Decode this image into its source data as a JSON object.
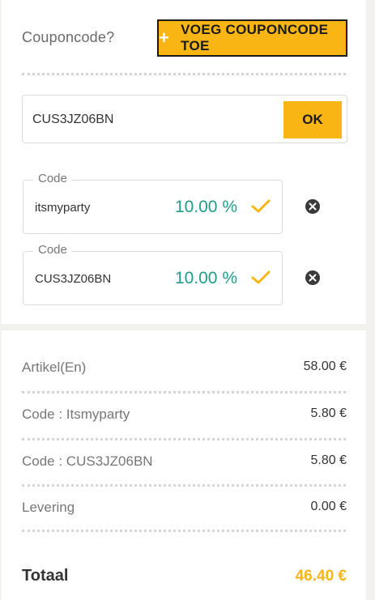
{
  "coupon": {
    "label": "Couponcode?",
    "add_button_icon": "plus-icon",
    "add_button_label": "VOEG COUPONCODE TOE",
    "input_value": "CUS3JZ06BN",
    "ok_label": "OK"
  },
  "applied_codes": [
    {
      "legend": "Code",
      "value": "itsmyparty",
      "discount": "10.00 %"
    },
    {
      "legend": "Code",
      "value": "CUS3JZ06BN",
      "discount": "10.00 %"
    }
  ],
  "summary": {
    "rows": [
      {
        "label": "Artikel(En)",
        "amount": "58.00 €"
      },
      {
        "label": "Code : Itsmyparty",
        "amount": "5.80 €"
      },
      {
        "label": "Code : CUS3JZ06BN",
        "amount": "5.80 €"
      },
      {
        "label": "Levering",
        "amount": "0.00 €"
      }
    ],
    "total_label": "Totaal",
    "total_amount": "46.40 €"
  },
  "colors": {
    "accent": "#f9b513",
    "discount": "#1f9c8a",
    "background": "#f3f1ee"
  }
}
